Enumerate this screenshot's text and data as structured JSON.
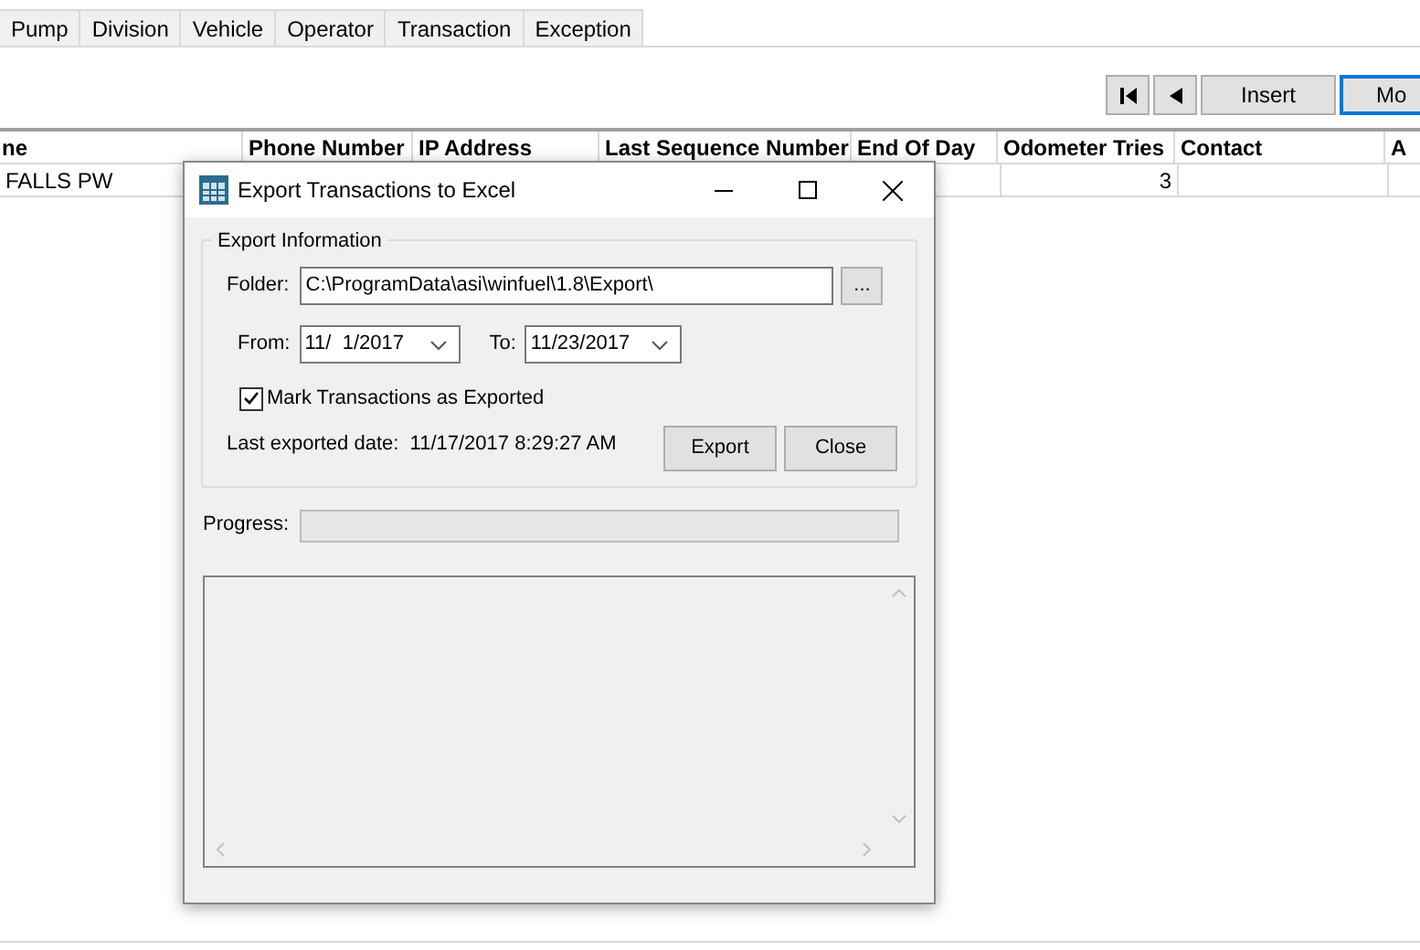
{
  "tabs": [
    {
      "label": "Pump",
      "selected": false
    },
    {
      "label": "Division",
      "selected": false
    },
    {
      "label": "Vehicle",
      "selected": false
    },
    {
      "label": "Operator",
      "selected": false
    },
    {
      "label": "Transaction",
      "selected": false
    },
    {
      "label": "Exception",
      "selected": false
    }
  ],
  "toolbar": [
    {
      "kind": "first",
      "focused": false
    },
    {
      "kind": "prev",
      "focused": false
    },
    {
      "kind": "text",
      "label": "Insert",
      "focused": false
    },
    {
      "kind": "text",
      "label": "Mo",
      "focused": true
    }
  ],
  "table": {
    "columns": [
      "ne",
      "Phone Number",
      "IP Address",
      "Last Sequence Number",
      "End Of Day",
      "Odometer Tries",
      "Contact",
      "A"
    ],
    "rows": [
      [
        "FALLS PW",
        "",
        "",
        "",
        "",
        "3",
        "",
        ""
      ]
    ]
  },
  "dialog": {
    "title": "Export Transactions to Excel",
    "group": "Export Information",
    "folder_label": "Folder:",
    "folder": "C:\\ProgramData\\asi\\winfuel\\1.8\\Export\\",
    "browse": "...",
    "from_label": "From:",
    "from": "11/  1/2017",
    "to_label": "To:",
    "to": "11/23/2017",
    "mark": {
      "label": "Mark Transactions as Exported",
      "checked": true
    },
    "last_exported": "Last exported date:  11/17/2017 8:29:27 AM",
    "buttons": [
      "Export",
      "Close"
    ],
    "progress_label": "Progress:",
    "progress": {
      "level": 0
    }
  }
}
